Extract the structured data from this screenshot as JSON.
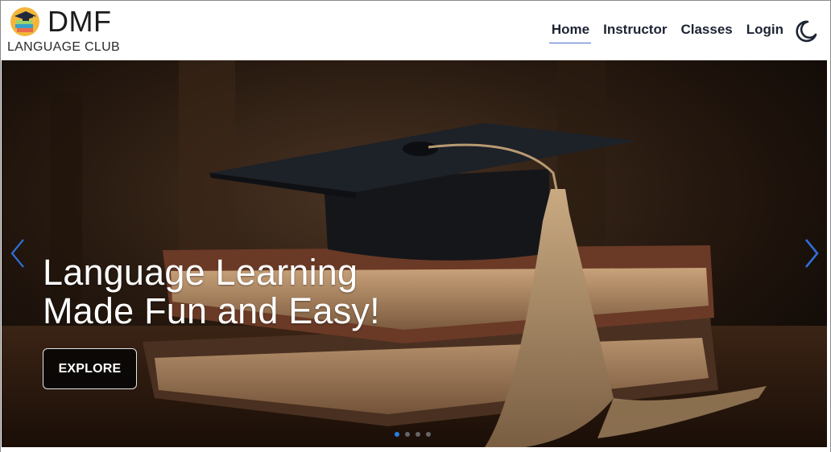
{
  "header": {
    "logo_title": "DMF",
    "logo_subtitle": "LANGUAGE CLUB",
    "nav": [
      {
        "label": "Home",
        "active": true
      },
      {
        "label": "Instructor",
        "active": false
      },
      {
        "label": "Classes",
        "active": false
      },
      {
        "label": "Login",
        "active": false
      }
    ],
    "theme_icon": "moon-icon"
  },
  "hero": {
    "headline_line1": "Language Learning",
    "headline_line2": "Made Fun and Easy!",
    "button_label": "EXPLORE",
    "slide_count": 4,
    "active_slide": 1,
    "prev_icon": "chevron-left-icon",
    "next_icon": "chevron-right-icon",
    "background_image": "graduation-cap-on-books"
  },
  "colors": {
    "accent": "#2b7de0",
    "nav_underline": "#4a6fc7",
    "text_dark": "#1d2433",
    "hero_caption": "#ffffff"
  }
}
